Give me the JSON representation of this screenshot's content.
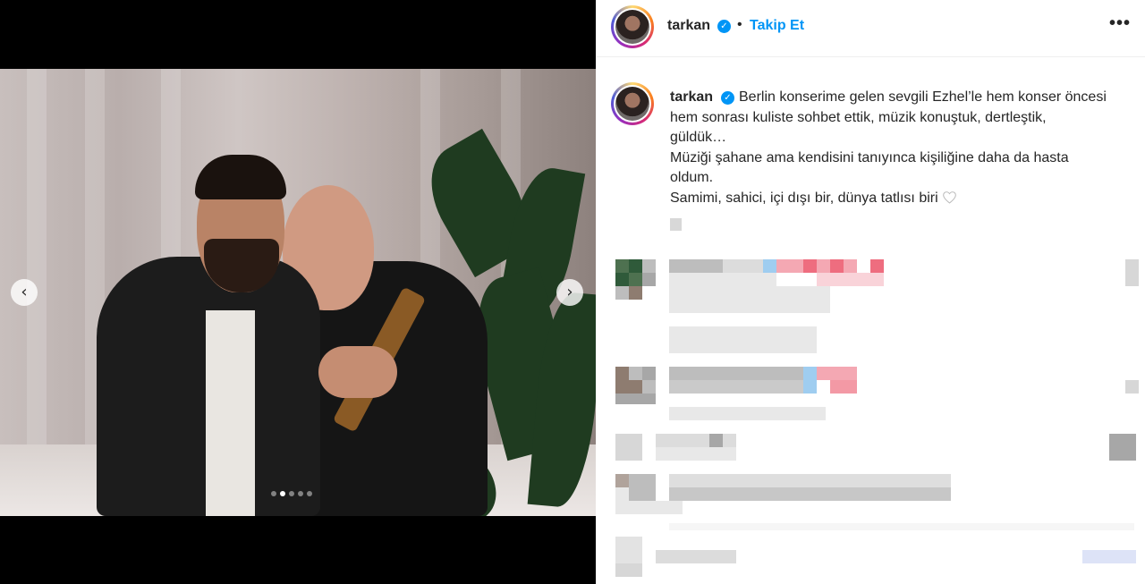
{
  "post": {
    "username": "tarkan",
    "follow_label": "Takip Et",
    "separator": "•",
    "more_label": "•••",
    "nav_prev": "‹",
    "nav_next": "›",
    "carousel_count": 5,
    "carousel_active_index": 1,
    "caption_line1": "Berlin konserime gelen sevgili Ezhel’le hem konser öncesi",
    "caption_line2": "hem sonrası kuliste sohbet ettik, müzik konuştuk, dertleştik,",
    "caption_line3": "güldük…",
    "caption_line4": "Müziği şahane ama kendisini tanıyınca kişiliğine daha da hasta",
    "caption_line5": "oldum.",
    "caption_line6": "Samimi, sahici, içi dışı bir, dünya tatlısı biri"
  },
  "icons": {
    "verified": "verified-badge-icon",
    "heart": "white-heart-icon",
    "prev": "chevron-left-icon",
    "next": "chevron-right-icon",
    "more": "more-options-icon"
  },
  "colors": {
    "link_blue": "#0095f6",
    "text": "#262626"
  }
}
